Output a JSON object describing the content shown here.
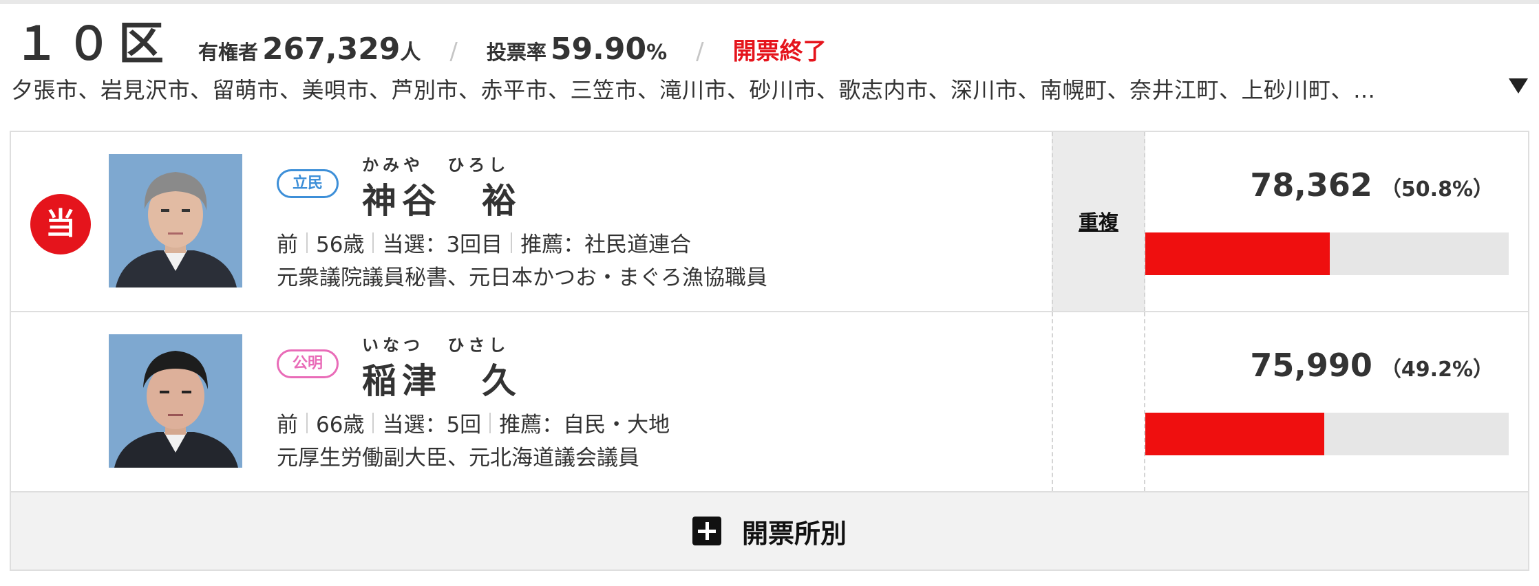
{
  "header": {
    "district": "１０区",
    "voters_label": "有権者",
    "voters_value": "267,329",
    "voters_unit": "人",
    "separator": "/",
    "turnout_label": "投票率",
    "turnout_value": "59.90",
    "turnout_unit": "%",
    "status": "開票終了"
  },
  "areas": "夕張市、岩見沢市、留萌市、美唄市、芦別市、赤平市、三笠市、滝川市、砂川市、歌志内市、深川市、南幌町、奈井江町、上砂川町、…",
  "candidates": [
    {
      "elected_mark": "当",
      "party": "立民",
      "kana": "かみや ひろし",
      "name": "神谷　裕",
      "status": "前",
      "age": "56歳",
      "wins": "当選：3回目",
      "endorse": "推薦：社民道連合",
      "career": "元衆議院議員秘書、元日本かつお・まぐろ漁協職員",
      "dup": "重複",
      "votes": "78,362",
      "pct_text": "（50.8%）",
      "share": 50.8
    },
    {
      "elected_mark": "",
      "party": "公明",
      "kana": "いなつ ひさし",
      "name": "稲津　久",
      "status": "前",
      "age": "66歳",
      "wins": "当選：5回",
      "endorse": "推薦：自民・大地",
      "career": "元厚生労働副大臣、元北海道議会議員",
      "dup": "",
      "votes": "75,990",
      "pct_text": "（49.2%）",
      "share": 49.2
    }
  ],
  "footer": {
    "label": "開票所別",
    "icon": "plus-icon"
  },
  "colors": {
    "accent": "#e5141c",
    "rikken": "#3d8fd8",
    "komei": "#e96cb8"
  }
}
